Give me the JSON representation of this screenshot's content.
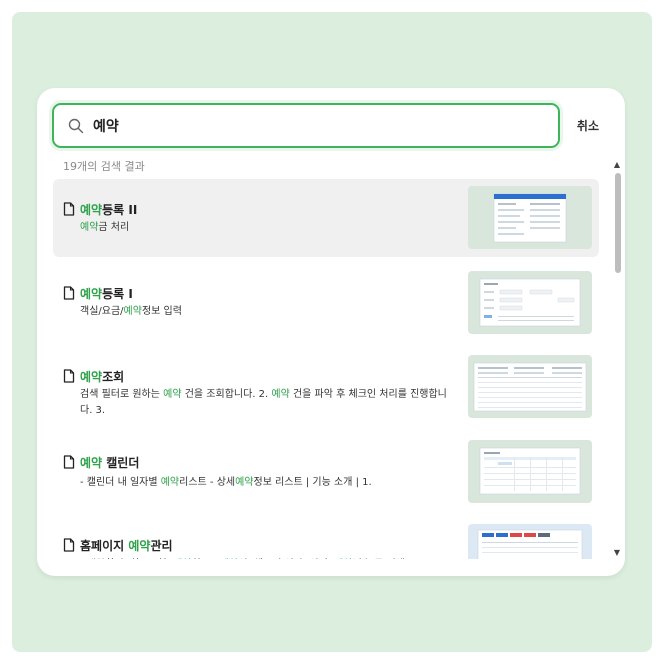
{
  "search": {
    "value": "예약",
    "cancel_label": "취소"
  },
  "result_count": "19개의 검색 결과",
  "results": [
    {
      "title_parts": [
        {
          "t": "예약",
          "hl": true
        },
        {
          "t": "등록 II",
          "hl": false
        }
      ],
      "desc_parts": [
        {
          "t": "예약",
          "hl": true
        },
        {
          "t": "금 처리",
          "hl": false
        }
      ],
      "thumb_bg": "#d8e6dc"
    },
    {
      "title_parts": [
        {
          "t": "예약",
          "hl": true
        },
        {
          "t": "등록 I",
          "hl": false
        }
      ],
      "desc_parts": [
        {
          "t": "객실/요금/",
          "hl": false
        },
        {
          "t": "예약",
          "hl": true
        },
        {
          "t": "정보 입력",
          "hl": false
        }
      ],
      "thumb_bg": "#d8e6dc"
    },
    {
      "title_parts": [
        {
          "t": "예약",
          "hl": true
        },
        {
          "t": "조회",
          "hl": false
        }
      ],
      "desc_parts": [
        {
          "t": "검색 필터로 원하는 ",
          "hl": false
        },
        {
          "t": "예약",
          "hl": true
        },
        {
          "t": " 건을 조회합니다. 2. ",
          "hl": false
        },
        {
          "t": "예약",
          "hl": true
        },
        {
          "t": " 건을 파악 후 체크인 처리를 진행합니다. 3.",
          "hl": false
        }
      ],
      "thumb_bg": "#d8e6dc"
    },
    {
      "title_parts": [
        {
          "t": "예약",
          "hl": true
        },
        {
          "t": " 캘린더",
          "hl": false
        }
      ],
      "desc_parts": [
        {
          "t": "- 캘린더 내 일자별 ",
          "hl": false
        },
        {
          "t": "예약",
          "hl": true
        },
        {
          "t": "리스트 - 상세",
          "hl": false
        },
        {
          "t": "예약",
          "hl": true
        },
        {
          "t": "정보 리스트 | 기능 소개 | 1.",
          "hl": false
        }
      ],
      "thumb_bg": "#d8e6dc"
    },
    {
      "title_parts": [
        {
          "t": "홈페이지 ",
          "hl": false
        },
        {
          "t": "예약",
          "hl": true
        },
        {
          "t": "관리",
          "hl": false
        }
      ],
      "desc_parts": [
        {
          "t": "- ",
          "hl": false
        },
        {
          "t": "예약",
          "hl": true
        },
        {
          "t": "확정, 취소요청, ",
          "hl": false
        },
        {
          "t": "예약",
          "hl": true
        },
        {
          "t": "취소 - ",
          "hl": false
        },
        {
          "t": "예약",
          "hl": true
        },
        {
          "t": "일, 체크인 일자, 성명, ",
          "hl": false
        },
        {
          "t": "예약",
          "hl": true
        },
        {
          "t": "번호 등 검색",
          "hl": false
        }
      ],
      "thumb_bg": "#dde8f5"
    }
  ],
  "icons": {
    "search": "search-icon",
    "document": "document-icon",
    "scroll_up": "scroll-up-icon",
    "scroll_down": "scroll-down-icon"
  },
  "colors": {
    "accent": "#3fb55b",
    "highlight_text": "#2fa24b",
    "background": "#dcefdf",
    "active_row": "#f0f0f0"
  }
}
